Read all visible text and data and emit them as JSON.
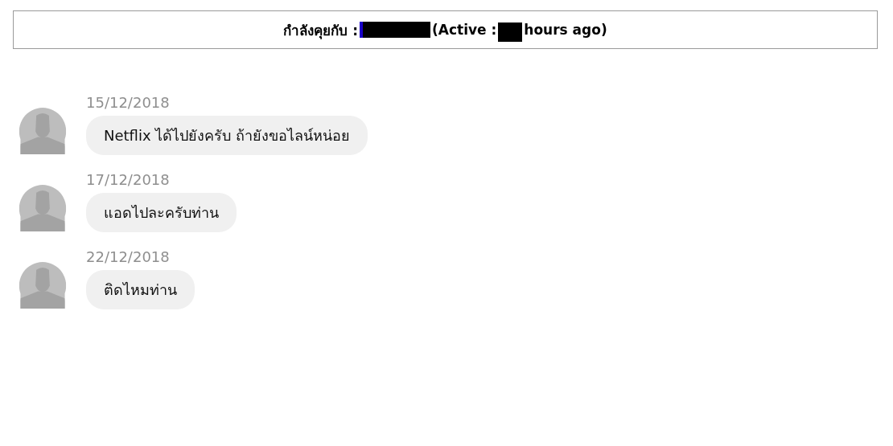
{
  "header": {
    "label": "กำลังคุยกับ :",
    "name_redacted": true,
    "active_prefix": "(Active :",
    "time_redacted": true,
    "active_suffix": "hours ago)"
  },
  "messages": [
    {
      "date": "15/12/2018",
      "text": "Netflix ได้ไปยังครับ ถ้ายังขอไลน์หน่อย"
    },
    {
      "date": "17/12/2018",
      "text": "แอดไปละครับท่าน"
    },
    {
      "date": "22/12/2018",
      "text": "ติดไหมท่าน"
    }
  ]
}
